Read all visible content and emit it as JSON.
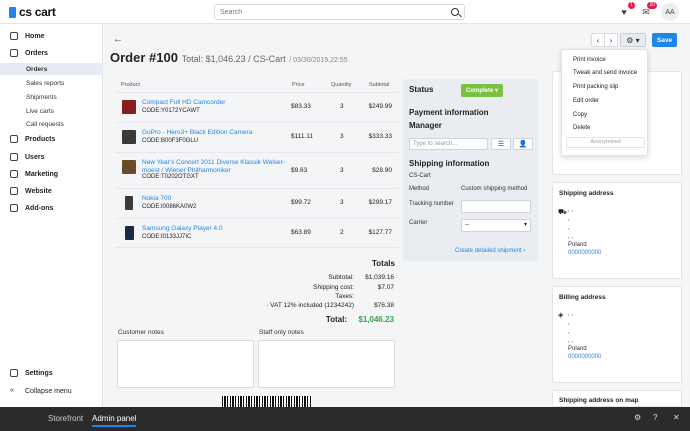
{
  "topbar": {
    "logo_text": "cs cart",
    "search_placeholder": "Search",
    "notifications_count": "1",
    "messages_count": "20",
    "avatar_initials": "AA"
  },
  "sidebar": {
    "items": [
      {
        "label": "Home"
      },
      {
        "label": "Orders"
      },
      {
        "label": "Orders"
      },
      {
        "label": "Sales reports"
      },
      {
        "label": "Shipments"
      },
      {
        "label": "Live carts"
      },
      {
        "label": "Call requests"
      },
      {
        "label": "Products"
      },
      {
        "label": "Users"
      },
      {
        "label": "Marketing"
      },
      {
        "label": "Website"
      },
      {
        "label": "Add-ons"
      }
    ],
    "settings_label": "Settings",
    "collapse_label": "Collapse menu"
  },
  "header": {
    "title": "Order #100",
    "total": "Total: $1,046.23 / CS-Cart",
    "date": "/ 03/30/2019,22:55",
    "save_label": "Save"
  },
  "products": {
    "headers": {
      "product": "Product",
      "price": "Price",
      "quantity": "Quantity",
      "subtotal": "Subtotal"
    },
    "rows": [
      {
        "name": "Compact Full HD Camcorder",
        "code": "CODE:Y0172YCAWT",
        "price": "$83.33",
        "qty": "3",
        "subtotal": "$249.99"
      },
      {
        "name": "GoPro - Hero3+ Black Edition Camera",
        "code": "CODE:B00F3F0GLU",
        "price": "$111.11",
        "qty": "3",
        "subtotal": "$333.33"
      },
      {
        "name": "New Year's Concert 2011 Diverse Klassik Welser-moest / Wiener Philharmoniker",
        "code": "CODE:T0202OTGXT",
        "price": "$9.63",
        "qty": "3",
        "subtotal": "$28.90"
      },
      {
        "name": "Nokia 700",
        "code": "CODE:I0086KA0W2",
        "price": "$99.72",
        "qty": "3",
        "subtotal": "$299.17"
      },
      {
        "name": "Samsung Galaxy Player 4.0",
        "code": "CODE:I0133JJ7IC",
        "price": "$63.89",
        "qty": "2",
        "subtotal": "$127.77"
      }
    ]
  },
  "totals": {
    "title": "Totals",
    "subtotal_label": "Subtotal:",
    "subtotal": "$1,039.16",
    "shipping_label": "Shipping cost:",
    "shipping": "$7.07",
    "taxes_label": "Taxes:",
    "vat_label": "· VAT 12% included (1234242)",
    "vat": "$76.38",
    "total_label": "Total:",
    "total": "$1,046.23"
  },
  "notes": {
    "customer_label": "Customer notes",
    "staff_label": "Staff only notes"
  },
  "status_panel": {
    "status_title": "Status",
    "status_value": "Complete",
    "payment_title": "Payment information",
    "manager_title": "Manager",
    "manager_placeholder": "Type to search...",
    "shipping_title": "Shipping information",
    "shipping_name": "CS-Cart",
    "method_label": "Method",
    "method_value": "Custom shipping method",
    "tracking_label": "Tracking number",
    "carrier_label": "Carrier",
    "carrier_value": "--",
    "detail_link": "Create detailed shipment ›"
  },
  "dropdown": {
    "items": [
      "Print invoice",
      "Tweak and send invoice",
      "Print packing slip",
      "Edit order",
      "Copy",
      "Delete"
    ],
    "anonymized": "Anonymized"
  },
  "cards": {
    "shipping_title": "Shipping address",
    "shipping_lines": [
      ", ,",
      ",",
      ",",
      ", ,"
    ],
    "shipping_country": "Poland",
    "shipping_phone": "0000000000",
    "billing_title": "Billing address",
    "billing_lines": [
      ", ,",
      ",",
      ",",
      ", ,"
    ],
    "billing_country": "Poland",
    "billing_phone": "0000000000",
    "map_title": "Shipping address on map"
  },
  "bottombar": {
    "storefront": "Storefront",
    "admin": "Admin panel",
    "accent": "#1f86e8"
  }
}
